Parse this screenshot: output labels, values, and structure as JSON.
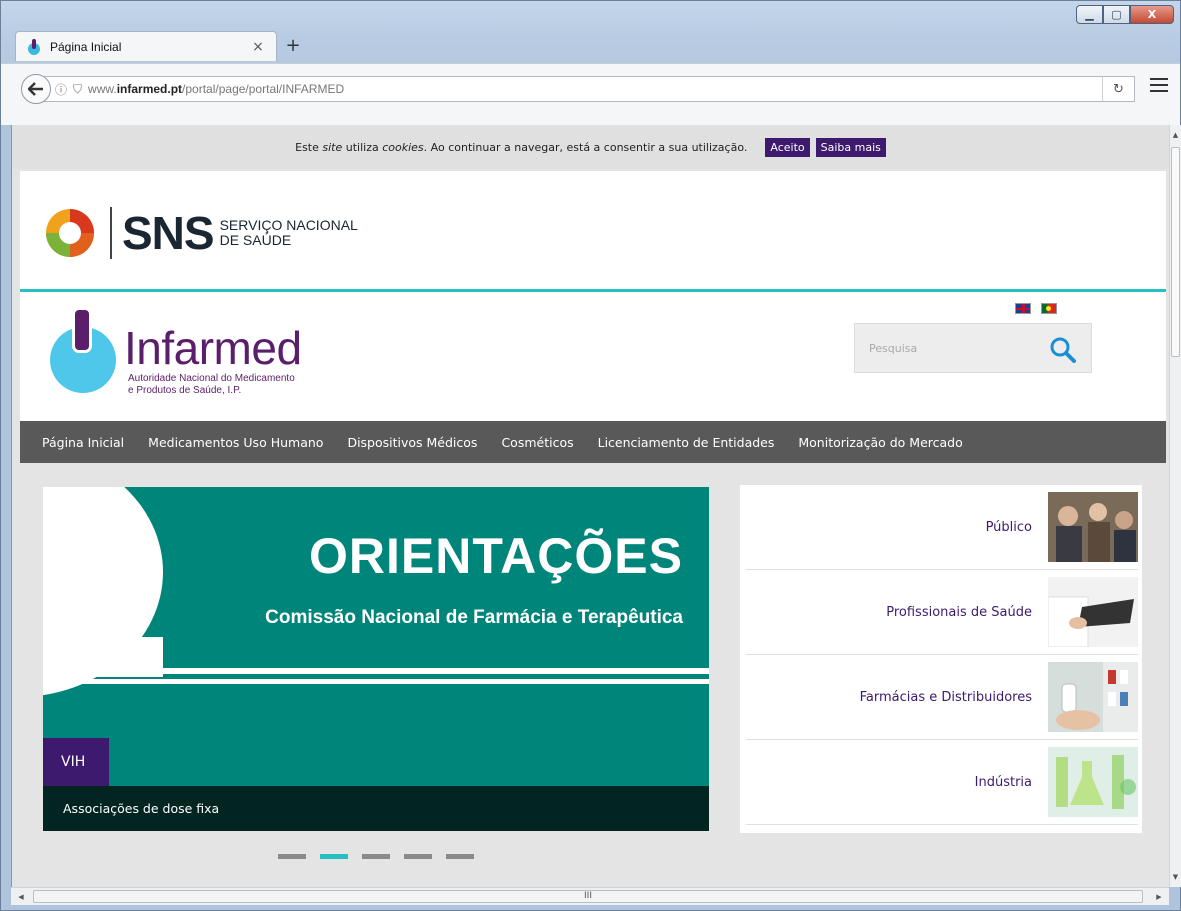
{
  "browser": {
    "tab_title": "Página Inicial",
    "tab_close": "×",
    "new_tab": "+",
    "url_domain": "www.infarmed.pt",
    "url_path": "/portal/page/portal/INFARMED",
    "url_prefix": "www.",
    "url_domain_bold": "infarmed.pt",
    "url_info_icon": "ⓘ",
    "url_shield_icon": "⛉",
    "reload_icon": "↻",
    "window_minimize": "▁",
    "window_maximize": "▢",
    "window_close": "X",
    "hscroll_grip": "III"
  },
  "cookie_bar": {
    "text_1": "Este ",
    "text_site": "site",
    "text_2": " utiliza ",
    "text_cookies": "cookies",
    "text_3": ". Ao continuar a navegar, está a consentir a sua utilização.",
    "accept_label": "Aceito",
    "more_label": "Saiba mais"
  },
  "sns": {
    "acronym": "SNS",
    "line1": "SERVIÇO NACIONAL",
    "line2": "DE SAÚDE"
  },
  "infarmed": {
    "name": "Infarmed",
    "sub_line1": "Autoridade Nacional do Medicamento",
    "sub_line2": "e Produtos de Saúde, I.P."
  },
  "search": {
    "placeholder": "Pesquisa"
  },
  "nav": {
    "items": [
      "Página Inicial",
      "Medicamentos Uso Humano",
      "Dispositivos Médicos",
      "Cosméticos",
      "Licenciamento de Entidades",
      "Monitorização do Mercado"
    ]
  },
  "slider": {
    "title": "ORIENTAÇÕES",
    "subtitle": "Comissão Nacional de Farmácia e Terapêutica",
    "tag": "VIH",
    "caption": "Associações de dose fixa",
    "active_index": 1,
    "count": 5
  },
  "audience": {
    "items": [
      "Público",
      "Profissionais de Saúde",
      "Farmácias e Distribuidores",
      "Indústria"
    ]
  },
  "colors": {
    "brand_purple": "#5a1f6b",
    "button_purple": "#3d1a6e",
    "teal": "#27bfc0",
    "slide_teal": "#00857b",
    "nav_gray": "#595959"
  },
  "icons": {
    "back": "arrow-left-icon",
    "info": "info-icon",
    "shield": "shield-icon",
    "reload": "reload-icon",
    "menu": "hamburger-menu-icon",
    "search": "search-icon",
    "flag_uk": "flag-uk-icon",
    "flag_pt": "flag-pt-icon"
  }
}
